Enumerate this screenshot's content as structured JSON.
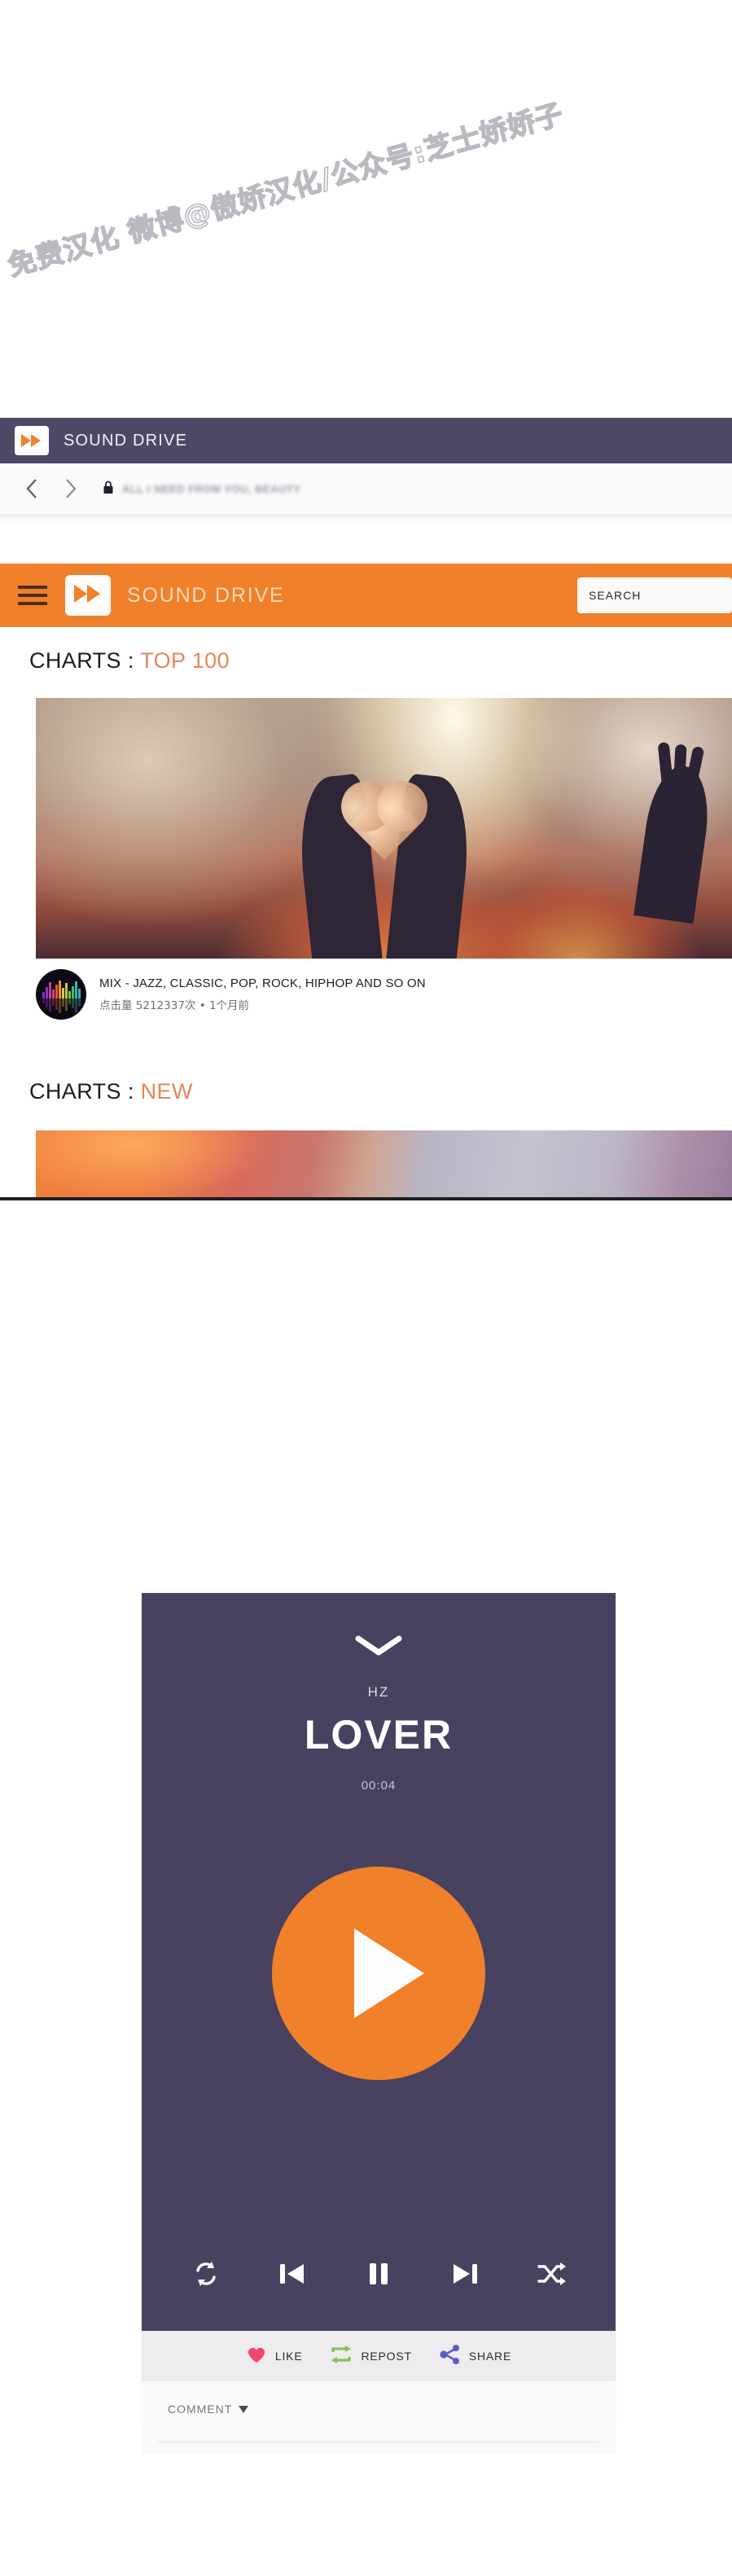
{
  "watermark": {
    "text": "免费汉化 微博@傲娇汉化/公众号:芝士娇娇子"
  },
  "browser": {
    "window_title": "SOUND DRIVE",
    "back_label": "Back",
    "forward_label": "Forward",
    "url_text": "ALL I NEED FROM YOU, BEAUTY",
    "lock_icon": "lock-icon"
  },
  "app_header": {
    "menu_icon": "hamburger-menu-icon",
    "logo_icon": "fast-forward-logo-icon",
    "title": "SOUND DRIVE",
    "search_placeholder": "SEARCH",
    "search_value": "",
    "background_color": "#f0802a"
  },
  "sections": [
    {
      "prefix": "CHARTS : ",
      "accent": "TOP 100",
      "accent_color": "#e08a56"
    },
    {
      "prefix": "CHARTS : ",
      "accent": "NEW",
      "accent_color": "#e08a56"
    }
  ],
  "featured_track": {
    "thumbnail_icon": "equalizer-thumbnail-icon",
    "title": "MIX - JAZZ, CLASSIC, POP, ROCK, HIPHOP AND SO ON",
    "meta": "点击量 5212337次 • 1个月前"
  },
  "player": {
    "collapse_icon": "chevron-down-icon",
    "artist": "HZ",
    "track": "LOVER",
    "elapsed": "00:04",
    "play_icon": "play-icon",
    "background_color": "#48415f",
    "accent_color": "#f0802a",
    "transport": [
      {
        "name": "repeat-button",
        "icon": "repeat-icon"
      },
      {
        "name": "previous-button",
        "icon": "skip-previous-icon"
      },
      {
        "name": "pause-button",
        "icon": "pause-icon"
      },
      {
        "name": "next-button",
        "icon": "skip-next-icon"
      },
      {
        "name": "shuffle-button",
        "icon": "shuffle-icon"
      }
    ],
    "social": [
      {
        "name": "like-button",
        "icon": "heart-icon",
        "label": "LIKE",
        "color": "#f2456f"
      },
      {
        "name": "repost-button",
        "icon": "repost-icon",
        "label": "REPOST",
        "color": "#83c25b"
      },
      {
        "name": "share-button",
        "icon": "share-icon",
        "label": "SHARE",
        "color": "#5b5bc8"
      }
    ],
    "comment": {
      "label": "COMMENT",
      "caret_icon": "caret-down-icon"
    }
  },
  "equalizer_colors": [
    "#7a2fb8",
    "#9b2fb8",
    "#c23fae",
    "#d9417a",
    "#e05a3a",
    "#e8962f",
    "#e8c92f",
    "#b9d13a",
    "#76c84a",
    "#3fbf6e",
    "#35b6a0",
    "#3aa7c4"
  ]
}
